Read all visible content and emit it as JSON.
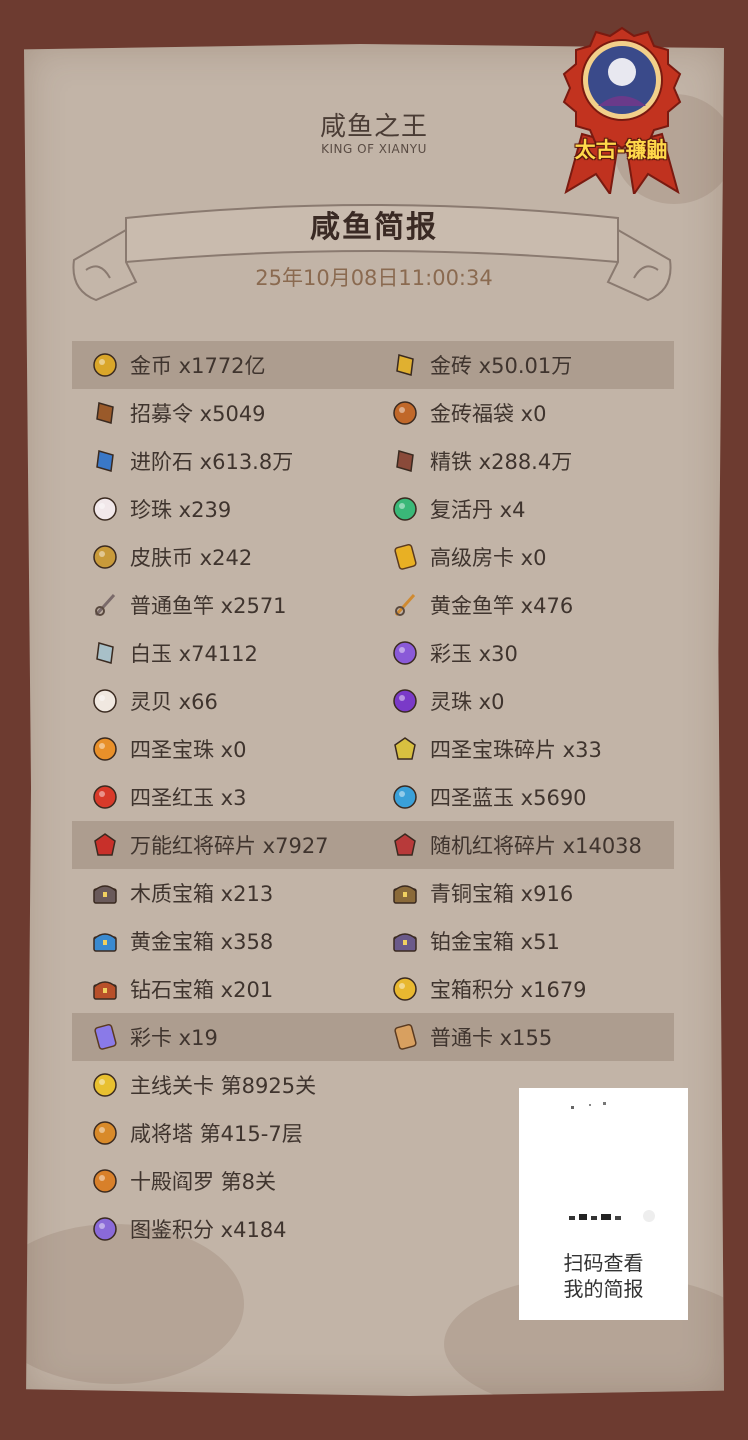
{
  "header": {
    "title_cn": "咸鱼之王",
    "title_en": "KING OF XIANYU",
    "banner_title": "咸鱼简报",
    "datetime": "25年10月08日11:00:34"
  },
  "badge": {
    "server_label": "太古-镰鼬"
  },
  "rows": [
    {
      "highlight": true,
      "left": {
        "icon": "gold-coin-icon",
        "text": "金币 x1772亿"
      },
      "right": {
        "icon": "gold-brick-icon",
        "text": "金砖 x50.01万"
      }
    },
    {
      "highlight": false,
      "left": {
        "icon": "recruit-token-icon",
        "text": "招募令 x5049"
      },
      "right": {
        "icon": "gold-bag-icon",
        "text": "金砖福袋 x0"
      }
    },
    {
      "highlight": false,
      "left": {
        "icon": "advance-stone-icon",
        "text": "进阶石 x613.8万"
      },
      "right": {
        "icon": "refined-iron-icon",
        "text": "精铁 x288.4万"
      }
    },
    {
      "highlight": false,
      "left": {
        "icon": "pearl-icon",
        "text": "珍珠 x239"
      },
      "right": {
        "icon": "revive-pill-icon",
        "text": "复活丹 x4"
      }
    },
    {
      "highlight": false,
      "left": {
        "icon": "skin-coin-icon",
        "text": "皮肤币 x242"
      },
      "right": {
        "icon": "room-card-icon",
        "text": "高级房卡 x0"
      }
    },
    {
      "highlight": false,
      "left": {
        "icon": "fishing-rod-icon",
        "text": "普通鱼竿 x2571"
      },
      "right": {
        "icon": "gold-rod-icon",
        "text": "黄金鱼竿 x476"
      }
    },
    {
      "highlight": false,
      "left": {
        "icon": "white-jade-icon",
        "text": "白玉 x74112"
      },
      "right": {
        "icon": "rainbow-jade-icon",
        "text": "彩玉 x30"
      }
    },
    {
      "highlight": false,
      "left": {
        "icon": "spirit-shell-icon",
        "text": "灵贝 x66"
      },
      "right": {
        "icon": "spirit-orb-icon",
        "text": "灵珠 x0"
      }
    },
    {
      "highlight": false,
      "left": {
        "icon": "holy-orb-icon",
        "text": "四圣宝珠 x0"
      },
      "right": {
        "icon": "orb-shard-icon",
        "text": "四圣宝珠碎片 x33"
      }
    },
    {
      "highlight": false,
      "left": {
        "icon": "red-jade-icon",
        "text": "四圣红玉 x3"
      },
      "right": {
        "icon": "blue-jade-icon",
        "text": "四圣蓝玉 x5690"
      }
    },
    {
      "highlight": true,
      "left": {
        "icon": "universal-shard-icon",
        "text": "万能红将碎片 x7927"
      },
      "right": {
        "icon": "random-shard-icon",
        "text": "随机红将碎片 x14038"
      }
    },
    {
      "highlight": false,
      "left": {
        "icon": "wood-chest-icon",
        "text": "木质宝箱 x213"
      },
      "right": {
        "icon": "bronze-chest-icon",
        "text": "青铜宝箱 x916"
      }
    },
    {
      "highlight": false,
      "left": {
        "icon": "gold-chest-icon",
        "text": "黄金宝箱 x358"
      },
      "right": {
        "icon": "platinum-chest-icon",
        "text": "铂金宝箱 x51"
      }
    },
    {
      "highlight": false,
      "left": {
        "icon": "diamond-chest-icon",
        "text": "钻石宝箱 x201"
      },
      "right": {
        "icon": "chest-points-icon",
        "text": "宝箱积分 x1679"
      }
    },
    {
      "highlight": true,
      "left": {
        "icon": "color-card-icon",
        "text": "彩卡 x19"
      },
      "right": {
        "icon": "normal-card-icon",
        "text": "普通卡 x155"
      }
    },
    {
      "highlight": false,
      "left": {
        "icon": "main-stage-icon",
        "text": "主线关卡 第8925关"
      }
    },
    {
      "highlight": false,
      "left": {
        "icon": "tower-icon",
        "text": "咸将塔 第415-7层"
      }
    },
    {
      "highlight": false,
      "left": {
        "icon": "yama-icon",
        "text": "十殿阎罗 第8关"
      }
    },
    {
      "highlight": false,
      "left": {
        "icon": "codex-points-icon",
        "text": "图鉴积分 x4184"
      }
    }
  ],
  "qr": {
    "line1": "扫码查看",
    "line2": "我的简报"
  },
  "icon_colors": {
    "gold-coin-icon": "#d9a62a",
    "gold-brick-icon": "#e0b030",
    "recruit-token-icon": "#9a5a2a",
    "gold-bag-icon": "#c0682a",
    "advance-stone-icon": "#3a78c8",
    "refined-iron-icon": "#8a4a3a",
    "pearl-icon": "#f1e8ea",
    "revive-pill-icon": "#3ab878",
    "skin-coin-icon": "#c89a3a",
    "room-card-icon": "#e8b024",
    "fishing-rod-icon": "#7a6a6a",
    "gold-rod-icon": "#d08a30",
    "white-jade-icon": "#a8c0c8",
    "rainbow-jade-icon": "#8a5ad8",
    "spirit-shell-icon": "#f0e8e0",
    "spirit-orb-icon": "#7a3ac8",
    "holy-orb-icon": "#e8902a",
    "orb-shard-icon": "#d8c040",
    "red-jade-icon": "#d83a2a",
    "blue-jade-icon": "#3aa0d8",
    "universal-shard-icon": "#c8302a",
    "random-shard-icon": "#b83a3a",
    "wood-chest-icon": "#6a5a5a",
    "bronze-chest-icon": "#8a6a3a",
    "gold-chest-icon": "#3a8ad0",
    "platinum-chest-icon": "#6a5a8a",
    "diamond-chest-icon": "#b8502a",
    "chest-points-icon": "#e8b830",
    "color-card-icon": "#8a7ae8",
    "normal-card-icon": "#d8a060",
    "main-stage-icon": "#e8c030",
    "tower-icon": "#d88a2a",
    "yama-icon": "#d8802a",
    "codex-points-icon": "#8a6ad8"
  }
}
